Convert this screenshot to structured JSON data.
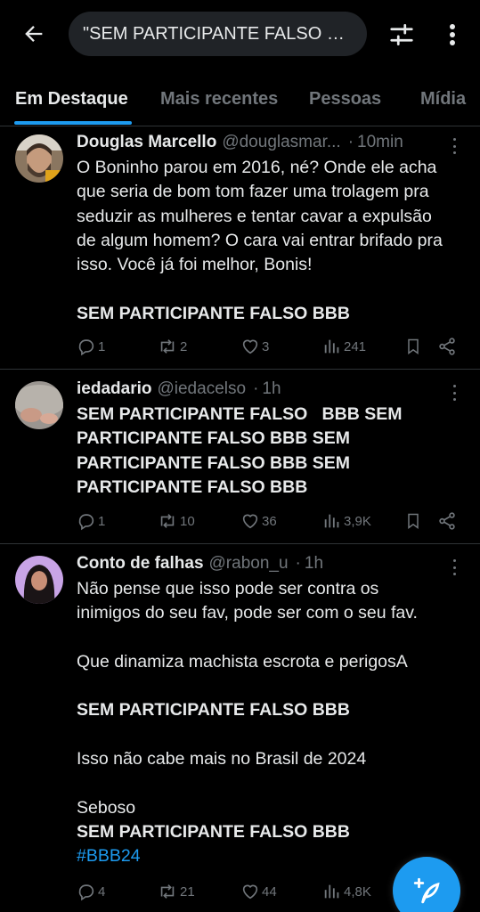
{
  "search": {
    "value": "\"SEM PARTICIPANTE FALSO BB..."
  },
  "tabs": [
    {
      "label": "Em Destaque",
      "active": true
    },
    {
      "label": "Mais recentes",
      "active": false
    },
    {
      "label": "Pessoas",
      "active": false
    },
    {
      "label": "Mídia",
      "active": false
    }
  ],
  "tweets": [
    {
      "name": "Douglas Marcello",
      "handle": "@douglasmar...",
      "time": "10min",
      "lines": [
        "O Boninho parou em 2016, né? Onde ele acha",
        "que seria de bom tom fazer uma trolagem pra",
        "seduzir as mulheres e tentar cavar a expulsão",
        "de algum homem? O cara vai entrar brifado pra",
        "isso. Você já foi melhor, Bonis!",
        "",
        "SEM PARTICIPANTE FALSO BBB"
      ],
      "replies": "1",
      "retweets": "2",
      "likes": "3",
      "views": "241"
    },
    {
      "name": "iedadario",
      "handle": "@iedacelso",
      "time": "1h",
      "lines": [
        "SEM PARTICIPANTE FALSO   BBB SEM",
        "PARTICIPANTE FALSO BBB SEM",
        "PARTICIPANTE FALSO BBB SEM",
        "PARTICIPANTE FALSO BBB"
      ],
      "replies": "1",
      "retweets": "10",
      "likes": "36",
      "views": "3,9K"
    },
    {
      "name": "Conto de falhas",
      "handle": "@rabon_u",
      "time": "1h",
      "lines": [
        "Não pense que isso pode ser contra os",
        "inimigos do seu fav, pode ser com o seu fav.",
        "",
        "Que dinamiza machista escrota e perigosA",
        "",
        "SEM PARTICIPANTE FALSO BBB",
        "",
        "Isso não cabe mais no Brasil de 2024",
        "",
        "Seboso",
        "SEM PARTICIPANTE FALSO BBB",
        "#BBB24"
      ],
      "replies": "4",
      "retweets": "21",
      "likes": "44",
      "views": "4,8K"
    }
  ],
  "colors": {
    "accent": "#1d9bf0",
    "background": "#000000",
    "muted": "#71767b",
    "text": "#e7e9ea"
  },
  "icons": [
    "back-arrow-icon",
    "filter-icon",
    "more-vertical-icon",
    "reply-icon",
    "retweet-icon",
    "like-icon",
    "views-icon",
    "bookmark-icon",
    "share-icon",
    "compose-icon"
  ]
}
